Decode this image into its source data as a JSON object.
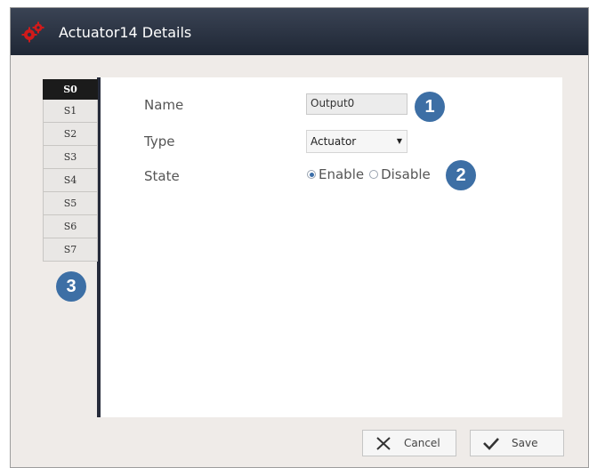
{
  "window": {
    "title": "Actuator14 Details",
    "icon": "gears-icon"
  },
  "slot_tabs": [
    "S0",
    "S1",
    "S2",
    "S3",
    "S4",
    "S5",
    "S6",
    "S7"
  ],
  "active_slot": "S0",
  "form": {
    "name_label": "Name",
    "name_value": "Output0",
    "type_label": "Type",
    "type_value": "Actuator",
    "state_label": "State",
    "state_options": [
      "Enable",
      "Disable"
    ],
    "state_selected": "Enable"
  },
  "markers": [
    "1",
    "2",
    "3"
  ],
  "buttons": {
    "cancel": "Cancel",
    "save": "Save"
  },
  "colors": {
    "titlebar": "#262d3b",
    "marker": "#3d6fa5",
    "accent_red": "#d11a1a"
  }
}
